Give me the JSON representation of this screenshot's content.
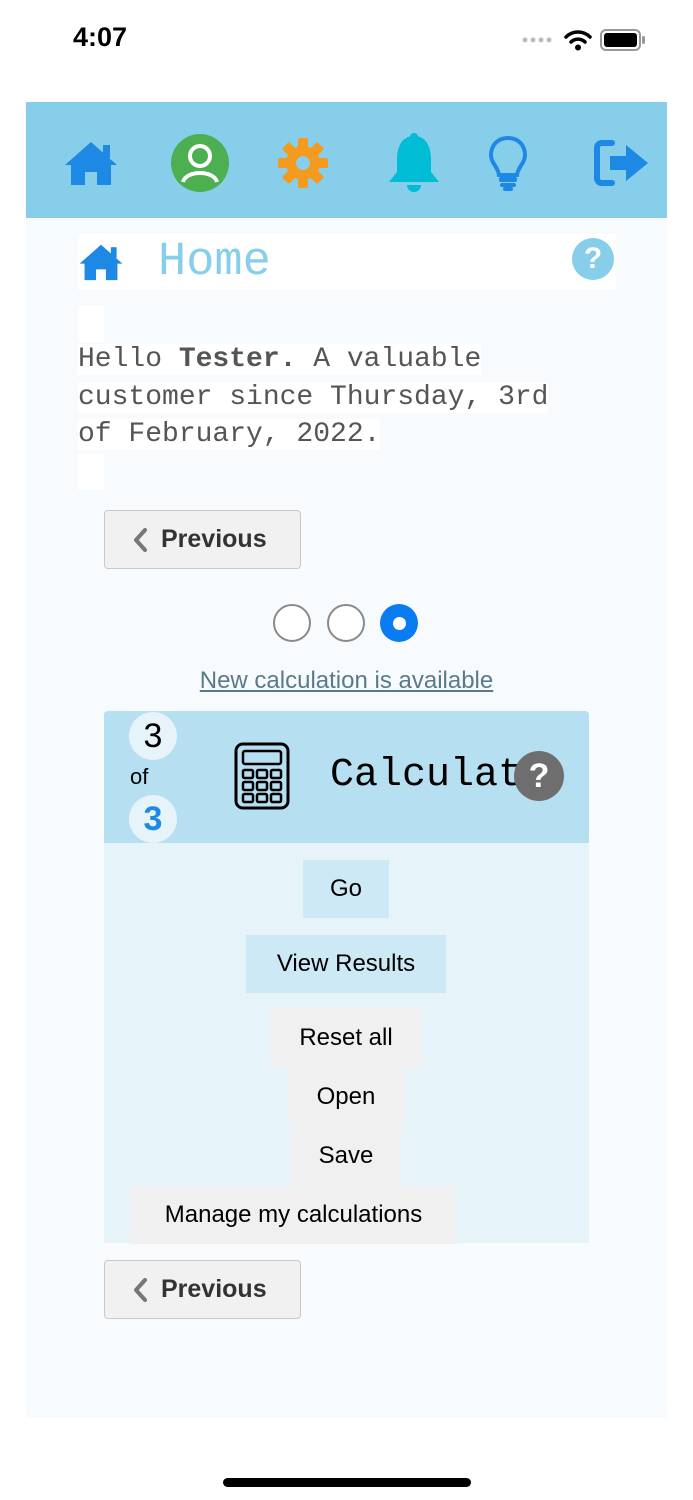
{
  "status_bar": {
    "time": "4:07"
  },
  "nav": {
    "items": [
      {
        "icon": "home-icon",
        "color": "#1e88e5"
      },
      {
        "icon": "profile-icon",
        "color": "#4caf50"
      },
      {
        "icon": "gear-icon",
        "color": "#f39a1f"
      },
      {
        "icon": "bell-icon",
        "color": "#00bcd4"
      },
      {
        "icon": "lightbulb-icon",
        "color": "#1e88e5"
      },
      {
        "icon": "logout-icon",
        "color": "#1e88e5"
      }
    ],
    "background": "#87ceeb"
  },
  "header": {
    "title": "Home",
    "help": "?"
  },
  "greeting": {
    "prefix": "Hello ",
    "name": "Tester.",
    "line_1_rest": " A valuable",
    "line_2": "customer since Thursday, 3rd",
    "line_3": "of February, 2022."
  },
  "buttons": {
    "previous_label": "Previous"
  },
  "pager": {
    "total_steps": 3,
    "current_step": 3
  },
  "new_calc_link": "New calculation is available",
  "card": {
    "step_current": "3",
    "of_label": "of",
    "step_total": "3",
    "title": "Calculator",
    "help": "?",
    "actions": {
      "go": "Go",
      "view_results": "View Results",
      "reset_all": "Reset all",
      "open": "Open",
      "save": "Save",
      "manage": "Manage my calculations"
    }
  }
}
